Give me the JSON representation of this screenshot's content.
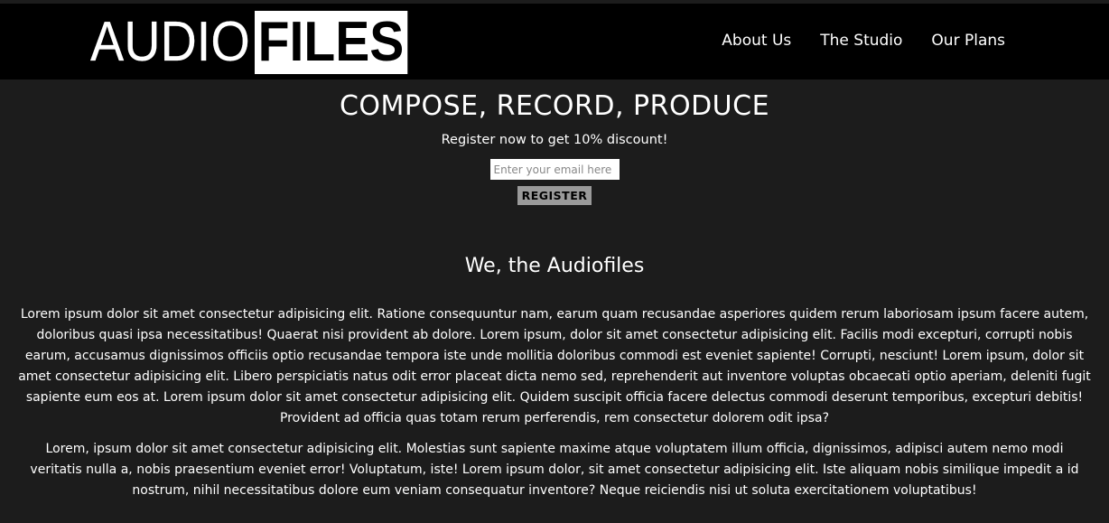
{
  "header": {
    "logo": {
      "part1": "AUDIO",
      "part2": "FILES"
    },
    "nav": [
      {
        "label": "About Us"
      },
      {
        "label": "The Studio"
      },
      {
        "label": "Our Plans"
      }
    ]
  },
  "hero": {
    "title": "COMPOSE, RECORD, PRODUCE",
    "promo": "Register now to get 10% discount!",
    "email_placeholder": "Enter your email here",
    "register_label": "REGISTER"
  },
  "about": {
    "heading": "We, the Audiofiles",
    "paragraphs": [
      "Lorem ipsum dolor sit amet consectetur adipisicing elit. Ratione consequuntur nam, earum quam recusandae asperiores quidem rerum laboriosam ipsum facere autem, doloribus quasi ipsa necessitatibus! Quaerat nisi provident ab dolore. Lorem ipsum, dolor sit amet consectetur adipisicing elit. Facilis modi excepturi, corrupti nobis earum, accusamus dignissimos officiis optio recusandae tempora iste unde mollitia doloribus commodi est eveniet sapiente! Corrupti, nesciunt! Lorem ipsum, dolor sit amet consectetur adipisicing elit. Libero perspiciatis natus odit error placeat dicta nemo sed, reprehenderit aut inventore voluptas obcaecati optio aperiam, deleniti fugit sapiente eum eos at. Lorem ipsum dolor sit amet consectetur adipisicing elit. Quidem suscipit officia facere delectus commodi deserunt temporibus, excepturi debitis! Provident ad officia quas totam rerum perferendis, rem consectetur dolorem odit ipsa?",
      "Lorem, ipsum dolor sit amet consectetur adipisicing elit. Molestias sunt sapiente maxime atque voluptatem illum officia, dignissimos, adipisci autem nemo modi veritatis nulla a, nobis praesentium eveniet error! Voluptatum, iste! Lorem ipsum dolor, sit amet consectetur adipisicing elit. Iste aliquam nobis similique impedit a id nostrum, nihil necessitatibus dolore eum veniam consequatur inventore? Neque reiciendis nisi ut soluta exercitationem voluptatibus!"
    ]
  },
  "colors": {
    "background": "#1c1c1c",
    "header_background": "#000000",
    "text": "#ffffff",
    "button": "#9a9a9a"
  }
}
